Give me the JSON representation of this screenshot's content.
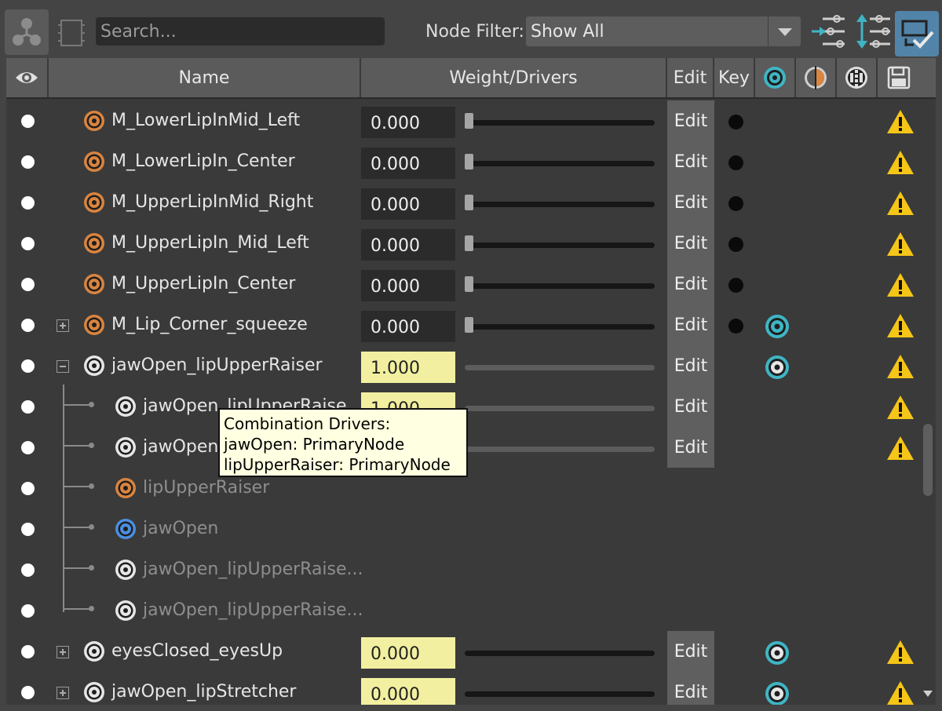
{
  "toolbar": {
    "search_placeholder": "Search...",
    "node_filter_label": "Node Filter:",
    "node_filter_value": "Show All"
  },
  "header": {
    "name": "Name",
    "weight": "Weight/Drivers",
    "edit": "Edit",
    "key": "Key"
  },
  "rows": [
    {
      "name": "M_LowerLipInMid_Left",
      "weight": "0.000",
      "edit": "Edit"
    },
    {
      "name": "M_LowerLipIn_Center",
      "weight": "0.000",
      "edit": "Edit"
    },
    {
      "name": "M_UpperLipInMid_Right",
      "weight": "0.000",
      "edit": "Edit"
    },
    {
      "name": "M_UpperLipIn_Mid_Left",
      "weight": "0.000",
      "edit": "Edit"
    },
    {
      "name": "M_UpperLipIn_Center",
      "weight": "0.000",
      "edit": "Edit"
    },
    {
      "name": "M_Lip_Corner_squeeze",
      "weight": "0.000",
      "edit": "Edit"
    },
    {
      "name": "jawOpen_lipUpperRaiser",
      "weight": "1.000",
      "edit": "Edit"
    },
    {
      "name": "jawOpen_lipUpperRaise",
      "weight": "1.000",
      "edit": "Edit"
    },
    {
      "name": "jawOpen_",
      "edit": "Edit"
    },
    {
      "name": "lipUpperRaiser"
    },
    {
      "name": "jawOpen"
    },
    {
      "name": "jawOpen_lipUpperRaise..."
    },
    {
      "name": "jawOpen_lipUpperRaise..."
    },
    {
      "name": "eyesClosed_eyesUp",
      "weight": "0.000",
      "edit": "Edit"
    },
    {
      "name": "jawOpen_lipStretcher",
      "weight": "0.000",
      "edit": "Edit"
    }
  ],
  "tooltip": {
    "line1": "Combination Drivers:",
    "line2": "jawOpen: PrimaryNode",
    "line3": "lipUpperRaiser: PrimaryNode"
  },
  "colors": {
    "accent_active": "#5184a8",
    "teal_icon": "#3fb5c4",
    "orange_icon": "#d9843f",
    "blue_icon": "#4a8fe0",
    "warning": "#f5c518",
    "weight_highlight": "#f2f0a0"
  },
  "icons": [
    "shape-editor-icon",
    "frame-icon",
    "add-target-icon",
    "sort-icon",
    "combo-icon",
    "driver-icon",
    "tween-icon",
    "save-icon",
    "visibility-eye-icon",
    "warning-icon"
  ]
}
